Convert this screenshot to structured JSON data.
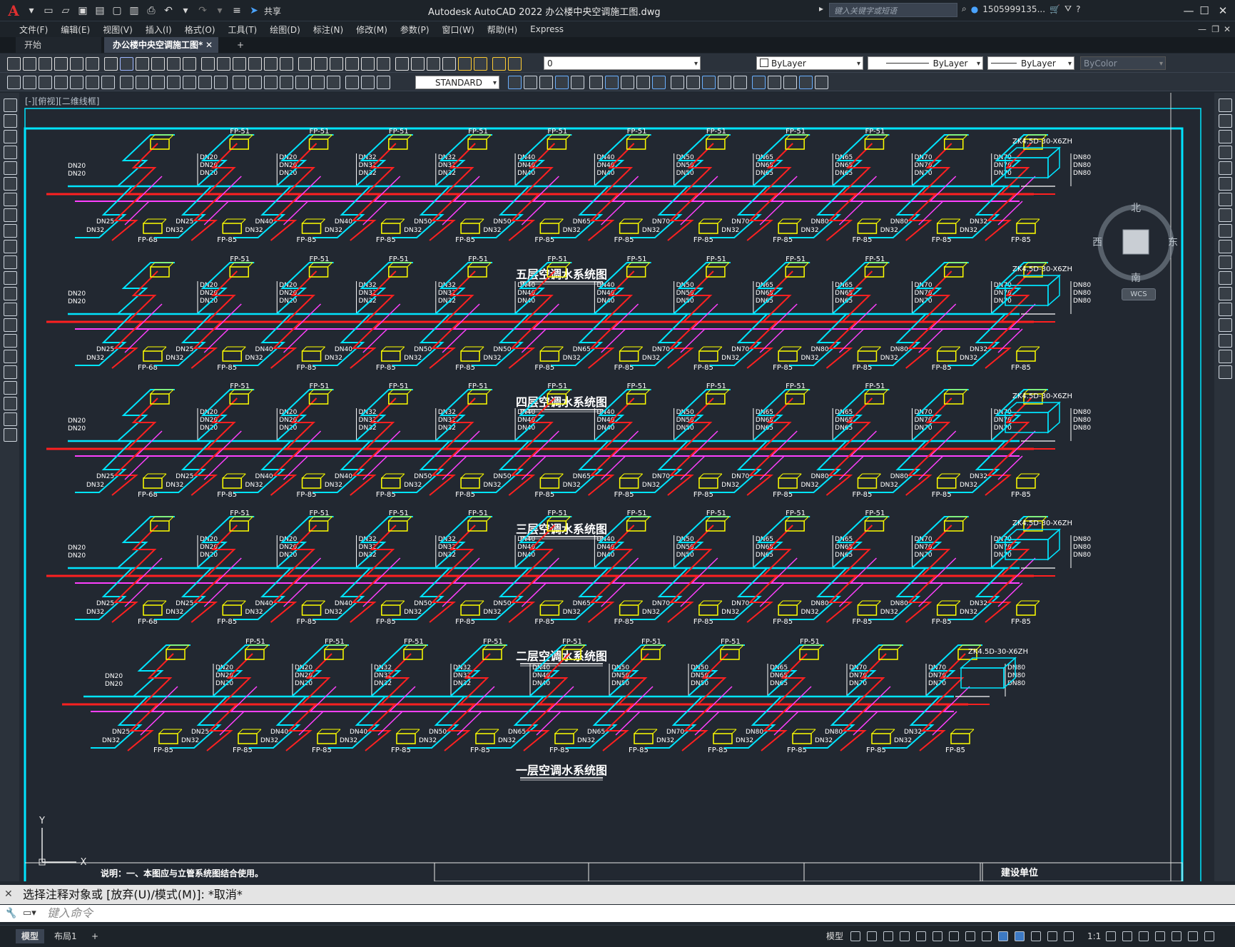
{
  "titlebar": {
    "app_title": "Autodesk AutoCAD 2022    办公楼中央空调施工图.dwg",
    "share_label": "共享",
    "search_placeholder": "键入关键字或短语",
    "user_name": "1505999135...",
    "window_controls": [
      "minimize-icon",
      "maximize-icon",
      "close-icon"
    ]
  },
  "menu": [
    "文件(F)",
    "编辑(E)",
    "视图(V)",
    "插入(I)",
    "格式(O)",
    "工具(T)",
    "绘图(D)",
    "标注(N)",
    "修改(M)",
    "参数(P)",
    "窗口(W)",
    "帮助(H)",
    "Express"
  ],
  "tabs": {
    "start": "开始",
    "active": "办公楼中央空调施工图*",
    "add": "+"
  },
  "properties": {
    "layer": "0",
    "color": "ByLayer",
    "linetype": "ByLayer",
    "lineweight": "ByLayer",
    "plotstyle": "ByColor",
    "textstyle": "STANDARD"
  },
  "viewport_label": "[-][俯视][二维线框]",
  "viewcube": {
    "north": "北",
    "south": "南",
    "east": "东",
    "west": "西",
    "wcs": "WCS"
  },
  "drawing": {
    "floors": [
      {
        "title": "五层空调水系统图",
        "ahu_label": "ZK4.5D-30-X6ZH"
      },
      {
        "title": "四层空调水系统图",
        "ahu_label": "ZK4.5D-30-X6ZH"
      },
      {
        "title": "三层空调水系统图",
        "ahu_label": "ZK4.5D-30-X6ZH"
      },
      {
        "title": "二层空调水系统图",
        "ahu_label": "ZK4.5D-30-X6ZH"
      },
      {
        "title": "一层空调水系统图",
        "ahu_label": "ZK4.5D-30-X6ZH"
      }
    ],
    "labels": {
      "fp51": "FP-51",
      "fp85": "FP-85",
      "fp68": "FP-68",
      "dn_top": [
        "DN20",
        "DN32",
        "DN40",
        "DN50",
        "DN65",
        "DN70",
        "DN80"
      ],
      "dn_bottom": [
        "DN25",
        "DN40",
        "DN50",
        "DN65",
        "DN70",
        "DN80",
        "DN32"
      ]
    },
    "note": "说明：一、本图应与立管系统图结合使用。",
    "title_block_label": "建设单位",
    "ucs_x": "X",
    "ucs_y": "Y"
  },
  "command": {
    "history": "选择注释对象或 [放弃(U)/模式(M)]: *取消*",
    "input_placeholder": "键入命令"
  },
  "status": {
    "layout_tabs": [
      "模型",
      "布局1"
    ],
    "add_tab": "+",
    "model_label": "模型",
    "scale": "1:1"
  }
}
